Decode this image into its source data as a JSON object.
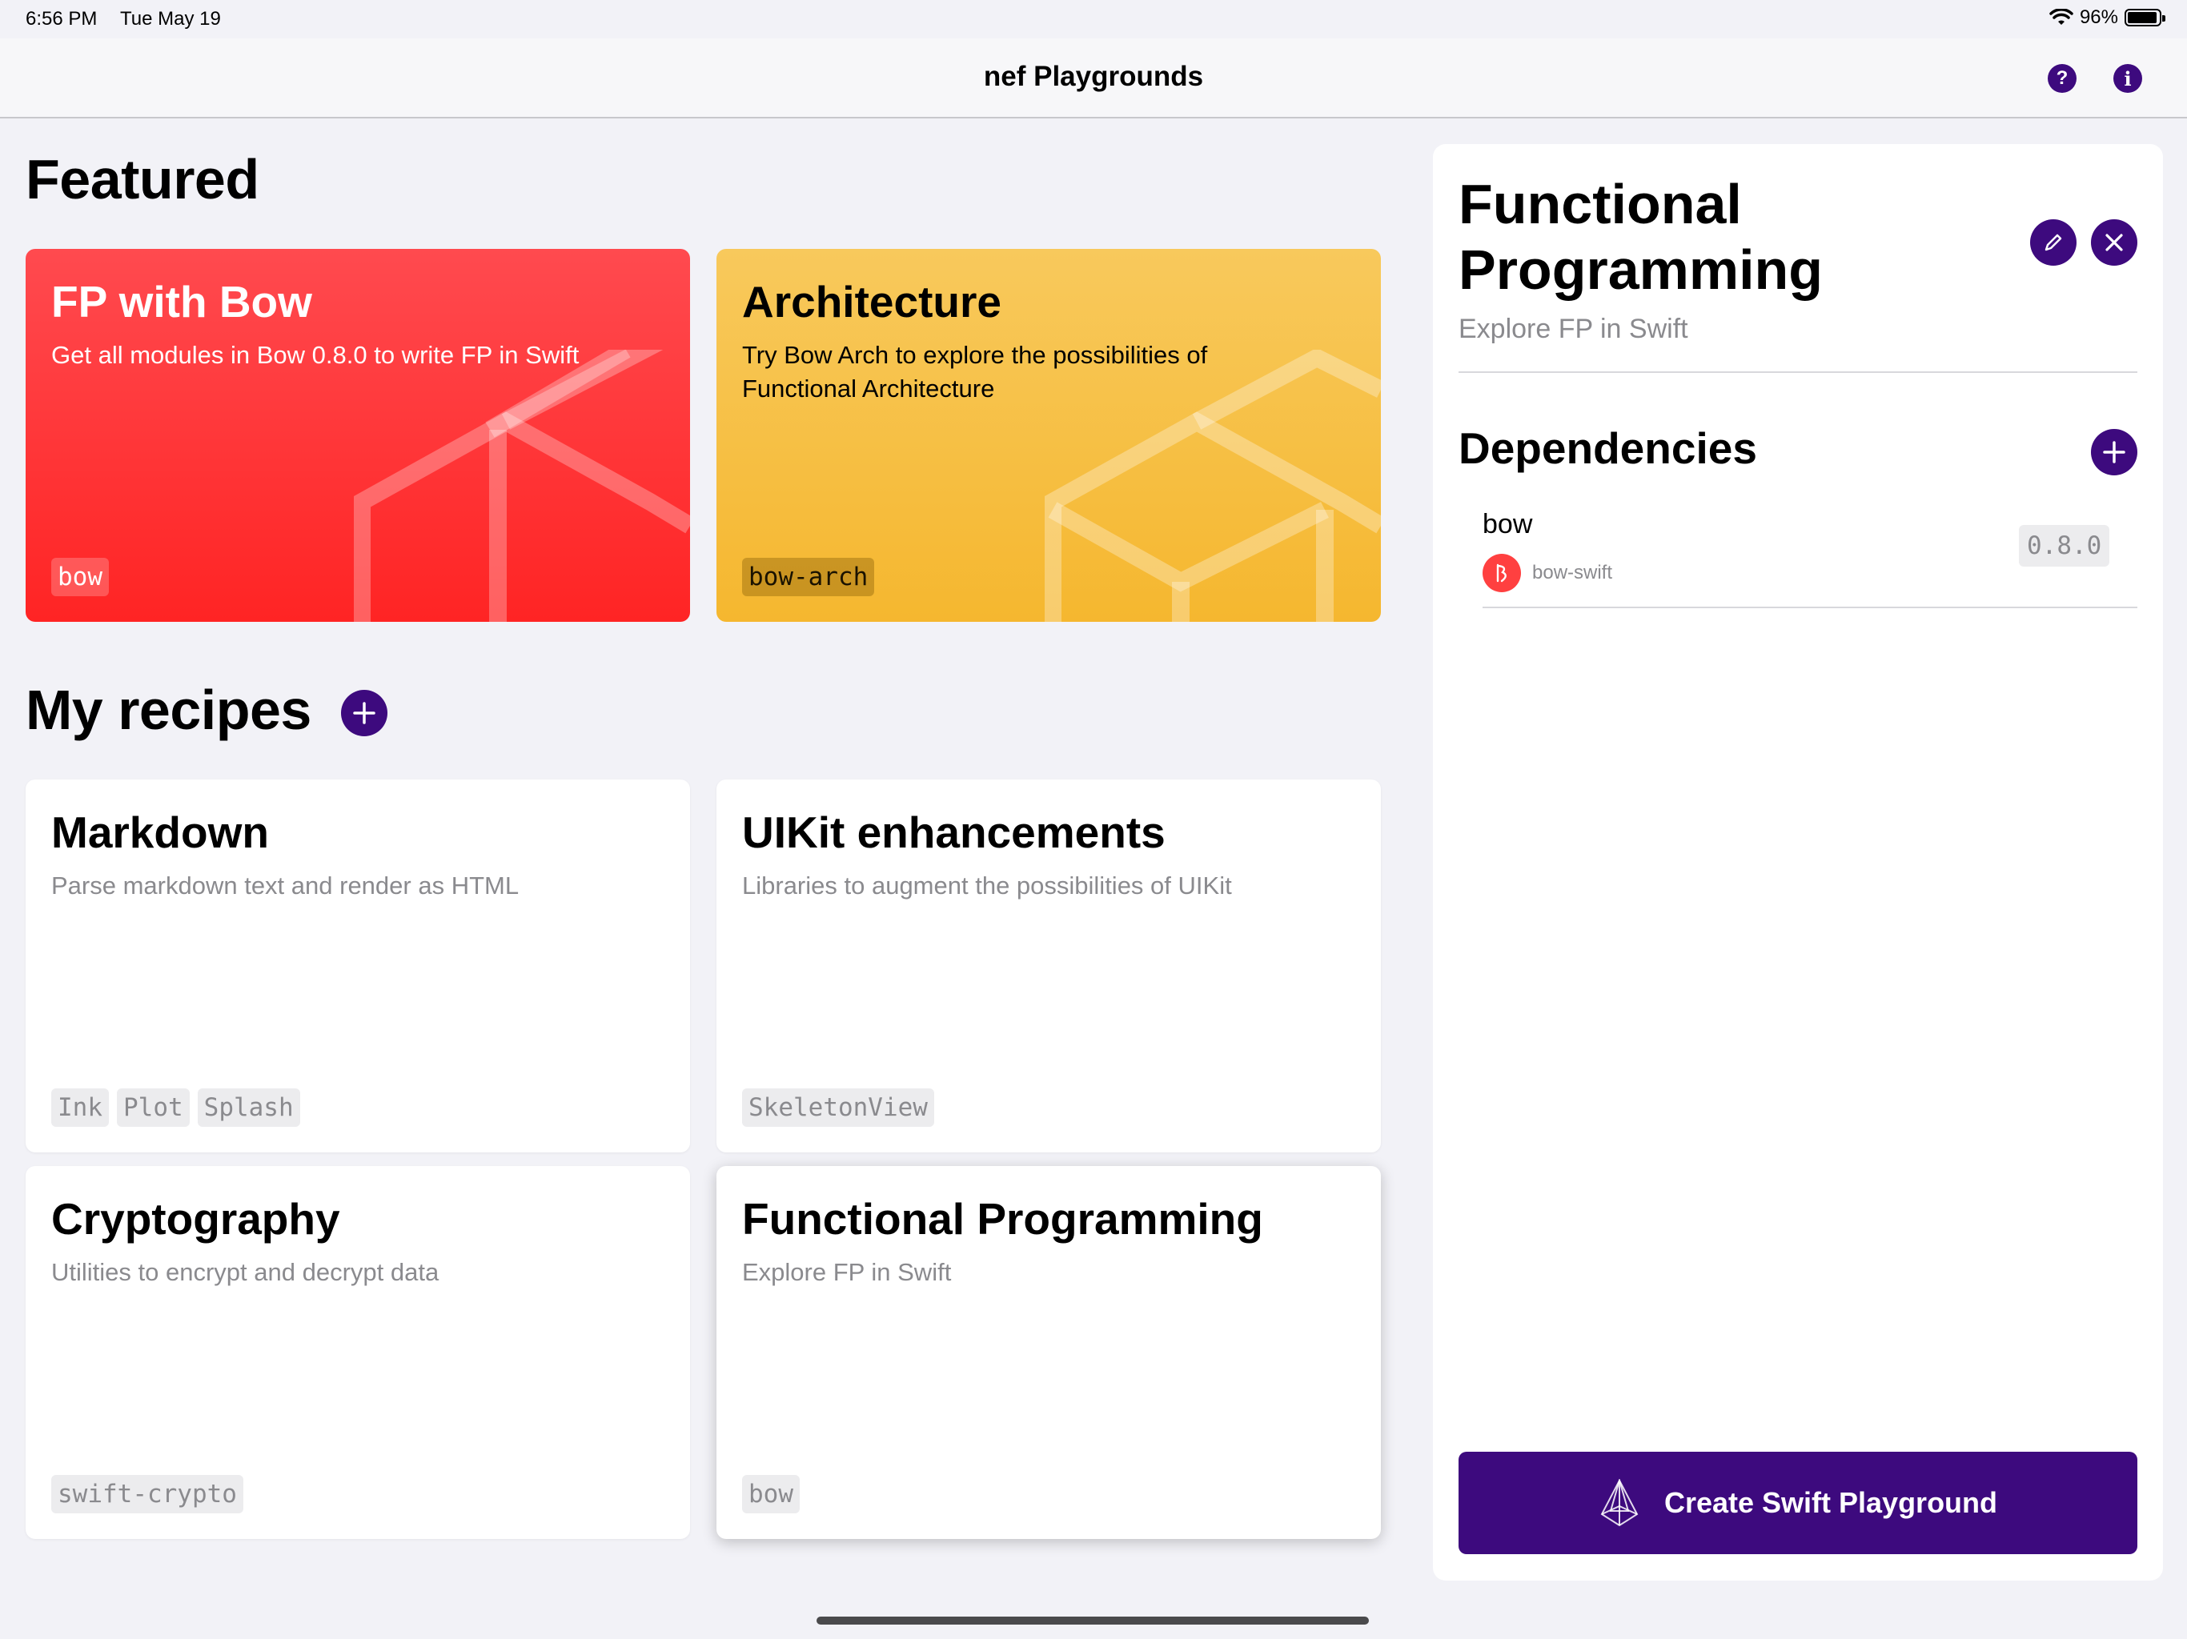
{
  "status_bar": {
    "time": "6:56 PM",
    "date": "Tue May 19",
    "battery_percent": "96%",
    "battery_level": 0.96
  },
  "navbar": {
    "title": "nef Playgrounds",
    "help_icon": "question-mark-icon",
    "info_icon": "info-icon"
  },
  "featured": {
    "title": "Featured",
    "cards": [
      {
        "title": "FP with Bow",
        "description": "Get all modules in Bow 0.8.0 to write FP in Swift",
        "tags": [
          "bow"
        ],
        "color": "#ff2e33"
      },
      {
        "title": "Architecture",
        "description": "Try Bow Arch to explore the possibilities of Functional Architecture",
        "tags": [
          "bow-arch"
        ],
        "color": "#f6be3f"
      }
    ]
  },
  "recipes": {
    "title": "My recipes",
    "items": [
      {
        "title": "Markdown",
        "description": "Parse markdown text and render as HTML",
        "tags": [
          "Ink",
          "Plot",
          "Splash"
        ]
      },
      {
        "title": "UIKit enhancements",
        "description": "Libraries to augment the possibilities of UIKit",
        "tags": [
          "SkeletonView"
        ]
      },
      {
        "title": "Cryptography",
        "description": "Utilities to encrypt and decrypt data",
        "tags": [
          "swift-crypto"
        ]
      },
      {
        "title": "Functional Programming",
        "description": "Explore FP in Swift",
        "tags": [
          "bow"
        ]
      }
    ]
  },
  "detail": {
    "title": "Functional Programming",
    "subtitle": "Explore FP in Swift",
    "dependencies_title": "Dependencies",
    "dependencies": [
      {
        "name": "bow",
        "repo": "bow-swift",
        "version": "0.8.0"
      }
    ],
    "create_button": "Create Swift Playground"
  },
  "colors": {
    "accent": "#3d0a7e",
    "background": "#f2f2f7"
  }
}
